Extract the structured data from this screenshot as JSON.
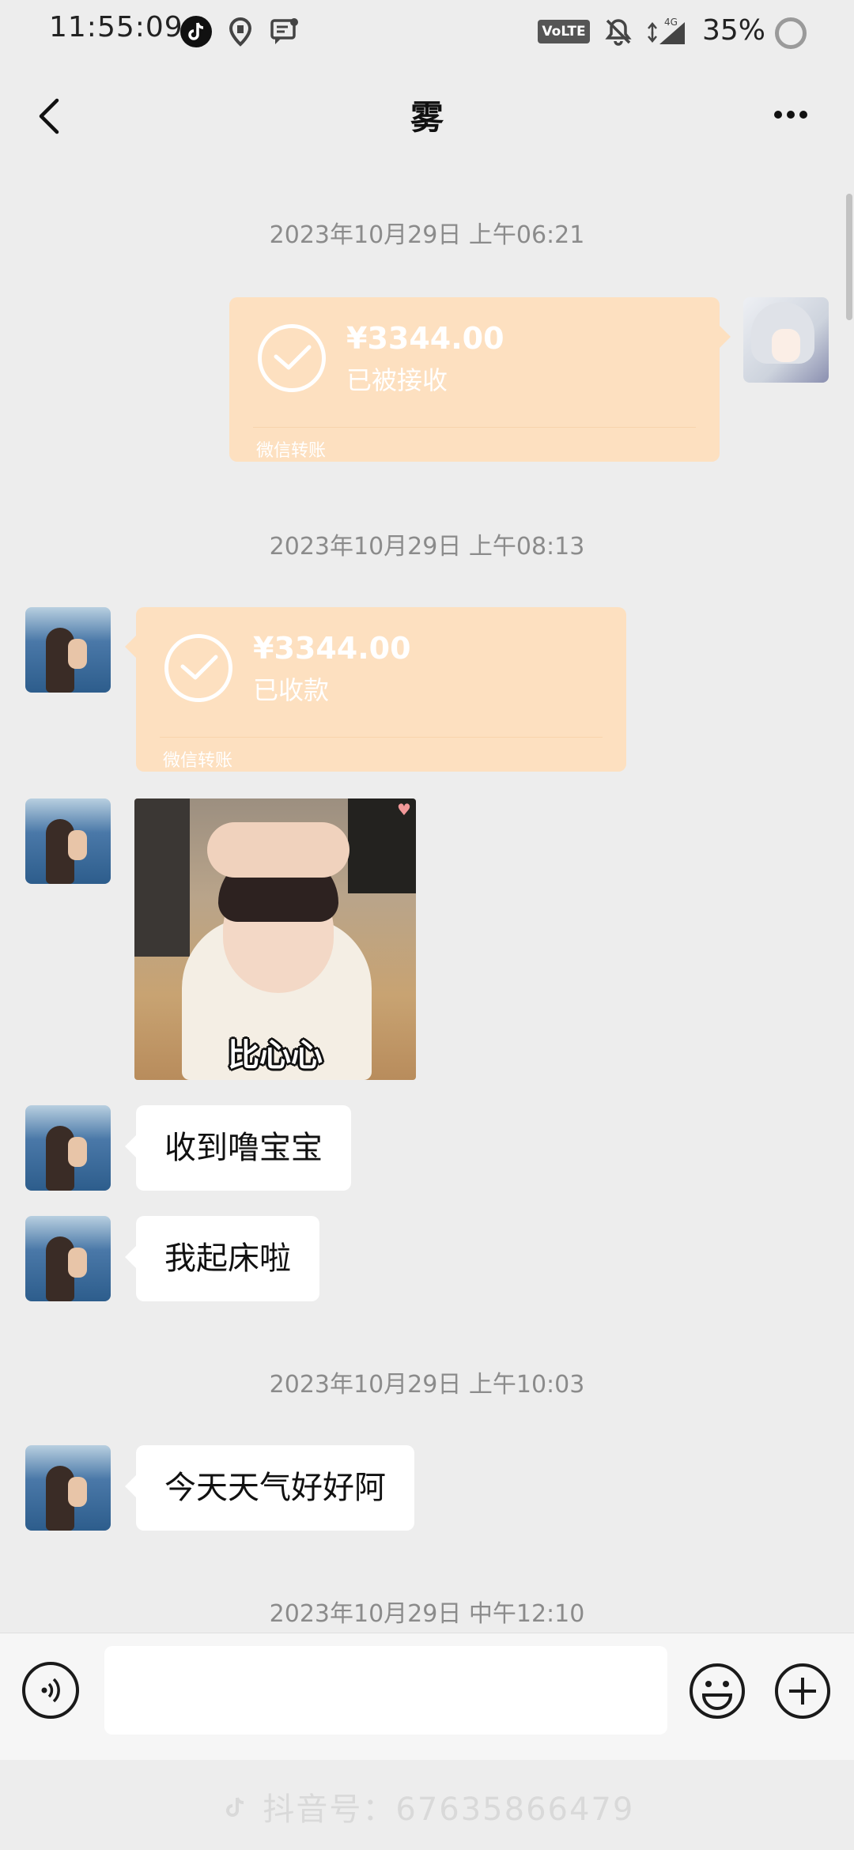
{
  "status_bar": {
    "time": "11:55:09",
    "network_badge": "VoLTE",
    "battery": "35%",
    "icons": [
      "tiktok-icon",
      "location-icon",
      "message-icon",
      "mute-icon",
      "signal-4g-icon",
      "battery-ring-icon"
    ]
  },
  "header": {
    "title": "雾",
    "back_icon": "chevron-left-icon",
    "more_icon": "more-dots-icon"
  },
  "messages": [
    {
      "type": "timestamp",
      "text": "2023年10月29日 上午06:21"
    },
    {
      "type": "transfer",
      "side": "right",
      "amount": "¥3344.00",
      "status": "已被接收",
      "source": "微信转账"
    },
    {
      "type": "timestamp",
      "text": "2023年10月29日 上午08:13"
    },
    {
      "type": "transfer",
      "side": "left",
      "amount": "¥3344.00",
      "status": "已收款",
      "source": "微信转账"
    },
    {
      "type": "sticker",
      "side": "left",
      "caption": "比心心"
    },
    {
      "type": "text",
      "side": "left",
      "text": "收到噜宝宝"
    },
    {
      "type": "text",
      "side": "left",
      "text": "我起床啦"
    },
    {
      "type": "timestamp",
      "text": "2023年10月29日 上午10:03"
    },
    {
      "type": "text",
      "side": "left",
      "text": "今天天气好好阿"
    },
    {
      "type": "timestamp",
      "text": "2023年10月29日 中午12:10"
    }
  ],
  "input_bar": {
    "placeholder": "",
    "value": ""
  },
  "watermark": {
    "text": "抖音号：67635866479"
  },
  "colors": {
    "background": "#ededed",
    "transfer_card": "#fde0c0",
    "bubble": "#ffffff"
  }
}
